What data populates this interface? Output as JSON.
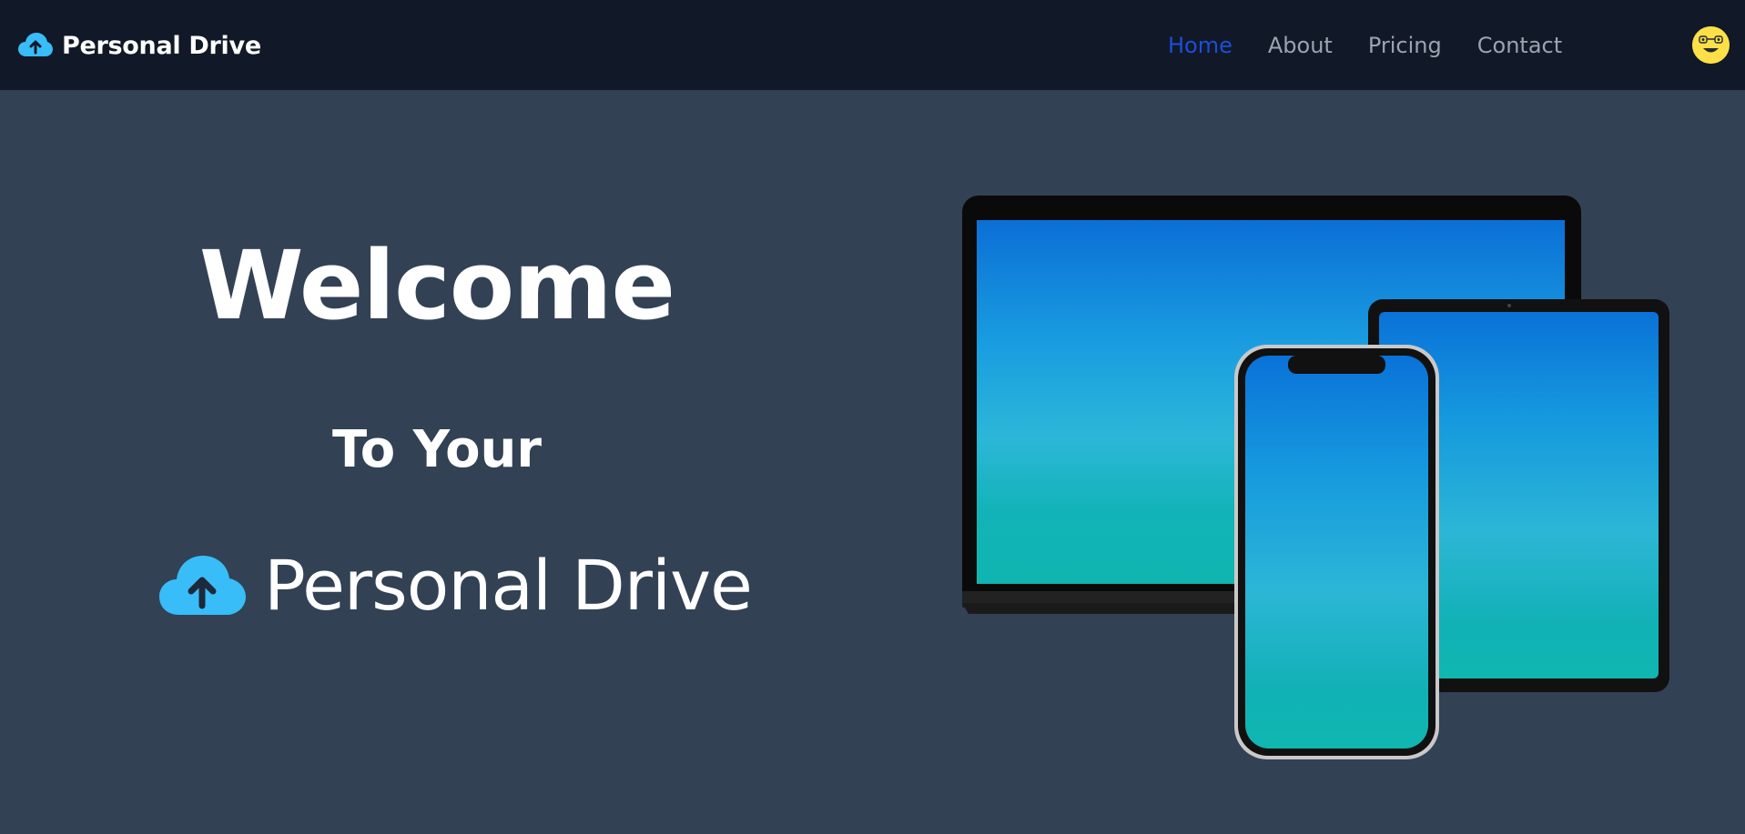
{
  "navbar": {
    "brand_icon": "cloud-upload-icon",
    "brand_label": "Personal Drive",
    "links": [
      {
        "label": "Home",
        "active": true
      },
      {
        "label": "About",
        "active": false
      },
      {
        "label": "Pricing",
        "active": false
      },
      {
        "label": "Contact",
        "active": false
      }
    ],
    "avatar_icon": "user-avatar-icon"
  },
  "hero": {
    "line1": "Welcome",
    "line2": "To Your",
    "brand_icon": "cloud-upload-icon",
    "brand_label": "Personal Drive",
    "image": "devices-mockup (laptop, tablet, phone)"
  },
  "colors": {
    "nav_bg": "#111827",
    "page_bg": "#334155",
    "active_link": "#1d4ed8",
    "inactive_link": "#9ca3af",
    "cloud_icon": "#38bdf8",
    "avatar_bg": "#fde047"
  }
}
